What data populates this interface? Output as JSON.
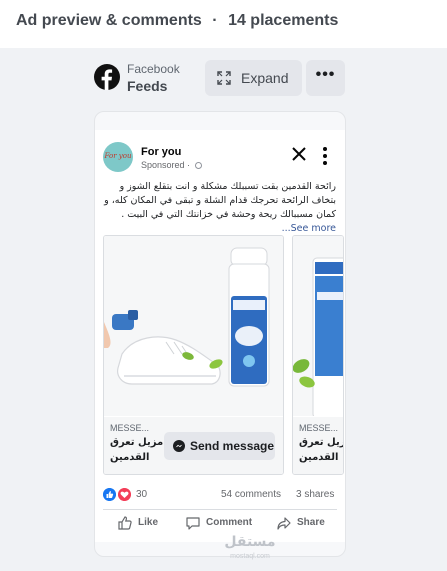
{
  "header": {
    "title": "Ad preview & comments",
    "separator": "·",
    "placements": "14 placements"
  },
  "placement": {
    "platform": "Facebook",
    "position": "Feeds",
    "expand_label": "Expand",
    "more_icon": "more-horizontal-icon"
  },
  "post": {
    "page_name": "For you",
    "avatar_text": "For you",
    "sponsored": "Sponsored ·",
    "text": "رائحة القدمين بقت تسببلك مشكلة و انت بتقلع الشوز و بتخاف الرائحة تحرجك قدام الشلة و تبقى في المكان كله، و كمان مسببالك ريحة وحشة في خزانتك التي في البيت .",
    "see_more": "See more..."
  },
  "carousel": [
    {
      "label": "MESSE...",
      "title": "مزيل تعرق القدمين",
      "cta": "Send message"
    },
    {
      "label": "MESSE...",
      "title": "مزيل تعرق القدمين"
    }
  ],
  "stats": {
    "reactions": "30",
    "comments": "54 comments",
    "shares": "3 shares"
  },
  "actions": {
    "like": "Like",
    "comment": "Comment",
    "share": "Share"
  },
  "watermark": {
    "text": "مستقل",
    "sub": "mostaql.com"
  },
  "colors": {
    "facebook_blue": "#1877f2",
    "love_red": "#f33e58",
    "background": "#f0f2f5",
    "button_gray": "#e4e6eb"
  }
}
